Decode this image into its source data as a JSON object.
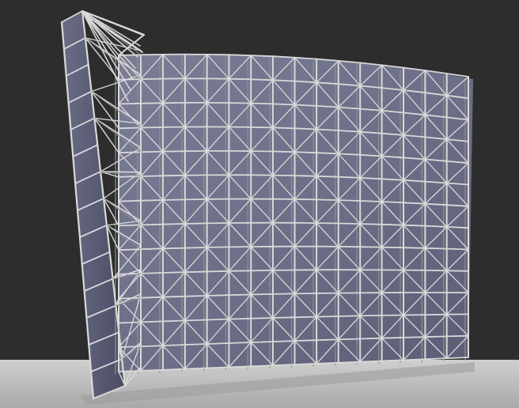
{
  "scene": {
    "subject": "space-frame-truss-wall",
    "colors": {
      "background": "#2d2d2d",
      "ground": "#b9b9b9",
      "ground_far": "#cfcfcf",
      "panel": "#6f7289",
      "panel_dark": "#4d5066",
      "side_panel": "#5e6078",
      "strut": "#d9d9d9",
      "strut_shadow": "#8f8f94"
    }
  }
}
